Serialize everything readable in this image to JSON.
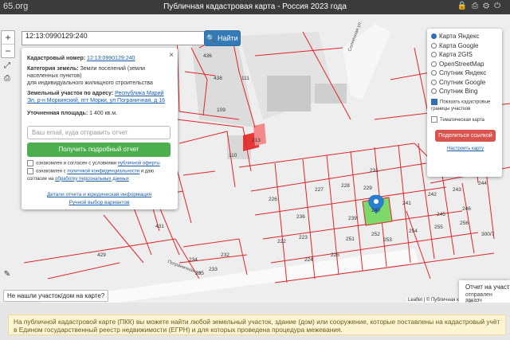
{
  "header": {
    "logo_text": "65.org",
    "title": "Публичная кадастровая карта - Россия 2023 года"
  },
  "search": {
    "value": "12:13:0990129:240",
    "button_label": "Найти"
  },
  "info_panel": {
    "cadastral_label": "Кадастровый номер:",
    "cadastral_value": "12:13:0990129:240",
    "category_label": "Категория земель:",
    "category_value": "Земли поселений (земли населенных пунктов)",
    "use_value": "для индивидуального жилищного строительства",
    "address_label": "Земельный участок по адресу:",
    "address_value": "Республика Марий Эл, р-н Моркинский, пгт Морки, ул Пограничная, д 16",
    "area_label": "Уточненная площадь:",
    "area_value": "1 400 кв.м.",
    "email_placeholder": "Ваш email, куда отправить отчет",
    "get_report_button": "Получить подробный отчет",
    "agree1_prefix": "ознакомлен и согласен с условиями",
    "agree1_link": "публичной оферты",
    "agree2_prefix": "ознакомлен с",
    "agree2_link": "политикой конфиденциальности",
    "agree2_mid": "и даю согласие на",
    "agree2_link2": "обработку персональных данных",
    "report_details_link": "Детали отчета и юридическая информация",
    "manual_choice_link": "Ручной выбор вариантов"
  },
  "layers": {
    "options": [
      {
        "label": "Карта Яндекс",
        "selected": true
      },
      {
        "label": "Карта Google",
        "selected": false
      },
      {
        "label": "Карта 2GIS",
        "selected": false
      },
      {
        "label": "OpenStreetMap",
        "selected": false
      },
      {
        "label": "Спутник Яндекс",
        "selected": false
      },
      {
        "label": "Спутник Google",
        "selected": false
      },
      {
        "label": "Спутник Bing",
        "selected": false
      }
    ],
    "show_borders": "Показать кадастровые границы участков",
    "thematic_map": "Тематическая карта",
    "share_button": "Поделиться ссылкой",
    "configure_link": "Настроить карту"
  },
  "map": {
    "zoom_in": "+",
    "zoom_out": "−",
    "fullscreen": "⤢",
    "print": "⎙",
    "ruler": "✎",
    "parcels": [
      "109",
      "110",
      "213",
      "231",
      "229",
      "226",
      "227",
      "228",
      "236",
      "239",
      "240",
      "241",
      "242",
      "243",
      "244",
      "245",
      "246",
      "251",
      "252",
      "253",
      "254",
      "255",
      "256",
      "300/7",
      "222",
      "223",
      "224",
      "225",
      "232",
      "233",
      "234",
      "235",
      "429",
      "431",
      "436",
      "438",
      "111"
    ],
    "street1": "Пограничная ул.",
    "street2": "Солнечная ул.",
    "attribution": "Leaflet | © Публичная к..."
  },
  "not_found_label": "Не нашли участок/дом на карте?",
  "report_popup": {
    "title": "Отчет на участ",
    "text": "отправлен заказч",
    "more": "Гар"
  },
  "banner_text": "На публичной кадастровой карте (ПКК) вы можете найти любой земельный участок, здание (дом) или сооружение, которые поставлены на кадастровый учёт в Едином государственный реестр недвижимости (ЕГРН) и для которых проведена процедура межевания.",
  "colors": {
    "boundary": "#e0252b",
    "selected_parcel": "#7cd96a",
    "marker": "#2a7fd4",
    "get_report": "#4cae4c",
    "find_button": "#337ab7"
  }
}
